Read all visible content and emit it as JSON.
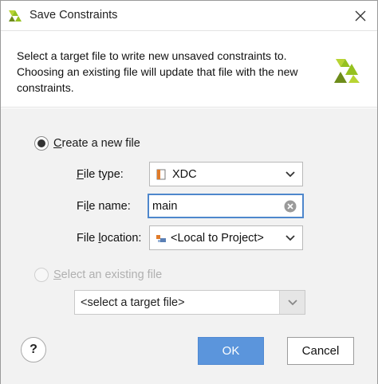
{
  "window": {
    "title": "Save Constraints",
    "logo_icon": "vivado-logo-icon",
    "close_icon": "close-icon"
  },
  "description": {
    "line1": "Select a target file to write new unsaved constraints to.",
    "line2": "Choosing an existing file will update that file with the new",
    "line3": "constraints."
  },
  "create_new": {
    "selected": true,
    "label_mnemonic": "C",
    "label_rest": "reate a new file",
    "file_type": {
      "label_mnemonic": "F",
      "label_rest": "ile type:",
      "value": "XDC",
      "icon": "xdc-file-icon"
    },
    "file_name": {
      "label_pre": "Fi",
      "label_mnemonic": "l",
      "label_rest": "e name:",
      "value": "main",
      "clear_icon": "clear-icon"
    },
    "file_location": {
      "label_pre": "File ",
      "label_mnemonic": "l",
      "label_rest": "ocation:",
      "value": "<Local to Project>",
      "icon": "local-project-icon"
    }
  },
  "select_existing": {
    "selected": false,
    "enabled": false,
    "label_mnemonic": "S",
    "label_rest": "elect an existing file",
    "placeholder": "<select a target file>"
  },
  "buttons": {
    "help": "?",
    "ok": "OK",
    "cancel": "Cancel"
  },
  "colors": {
    "accent": "#5b95dc",
    "focus_border": "#4e87cc",
    "logo_green": "#95c11f",
    "logo_dark": "#6d8c1a"
  }
}
